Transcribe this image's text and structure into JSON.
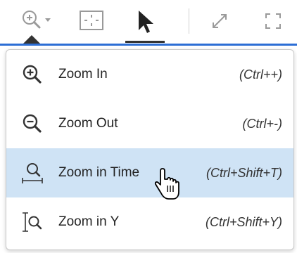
{
  "toolbar": {
    "buttons": [
      {
        "name": "zoom-dropdown-button",
        "icon": "zoom-in-icon"
      },
      {
        "name": "fit-to-view-button",
        "icon": "fit-frame-icon"
      },
      {
        "name": "select-pointer-button",
        "icon": "cursor-arrow-icon",
        "active": true
      },
      {
        "name": "expand-button",
        "icon": "expand-arrows-icon"
      },
      {
        "name": "fullscreen-button",
        "icon": "fullscreen-corners-icon"
      }
    ],
    "accent_color": "#2c6ed5"
  },
  "menu": {
    "items": [
      {
        "label": "Zoom In",
        "shortcut": "(Ctrl++)",
        "icon": "zoom-in-icon",
        "highlighted": false
      },
      {
        "label": "Zoom Out",
        "shortcut": "(Ctrl+-)",
        "icon": "zoom-out-icon",
        "highlighted": false
      },
      {
        "label": "Zoom in Time",
        "shortcut": "(Ctrl+Shift+T)",
        "icon": "zoom-time-icon",
        "highlighted": true
      },
      {
        "label": "Zoom in Y",
        "shortcut": "(Ctrl+Shift+Y)",
        "icon": "zoom-y-icon",
        "highlighted": false
      }
    ],
    "highlight_color": "#cfe3f5"
  },
  "cursor": {
    "icon": "hand-pointer-icon"
  }
}
